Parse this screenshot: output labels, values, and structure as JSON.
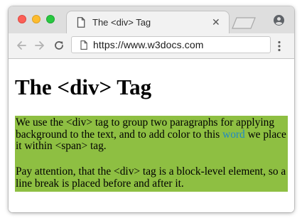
{
  "browser": {
    "tab": {
      "title": "The <div> Tag",
      "page_icon": "page-icon",
      "close_icon": "close-icon",
      "close_glyph": "✕"
    },
    "new_tab_icon": "new-tab-icon",
    "account_icon": "account-icon",
    "toolbar": {
      "back_icon": "back-arrow-icon",
      "forward_icon": "forward-arrow-icon",
      "reload_icon": "reload-icon",
      "url": "https://www.w3docs.com",
      "page_icon": "page-icon",
      "menu_icon": "kebab-menu-icon"
    },
    "traffic_lights": {
      "close_color": "#fc5f57",
      "minimize_color": "#fdbc2e",
      "zoom_color": "#28c840"
    }
  },
  "page": {
    "heading": "The <div> Tag",
    "block_background": "#8ebf42",
    "paragraph1": {
      "text_before": "We use the <div> tag to group two paragraphs for applying background to the text, and to add color to this ",
      "highlight_word": "word",
      "highlight_color": "#1e88c7",
      "text_after": " we place it within <span> tag."
    },
    "paragraph2": "Pay attention, that the <div> tag is a block-level element, so a line break is placed before and after it."
  }
}
